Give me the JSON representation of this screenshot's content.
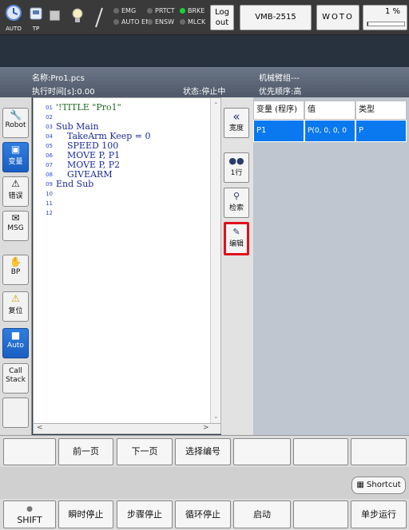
{
  "topbar": {
    "auto_label": "AUTO",
    "tp_label": "TP",
    "status": [
      {
        "label": "EMG",
        "on": false
      },
      {
        "label": "AUTO EN",
        "on": false
      },
      {
        "label": "PRTCT",
        "on": false
      },
      {
        "label": "ENSW",
        "on": false
      },
      {
        "label": "BRKE",
        "on": true
      },
      {
        "label": "MLCK",
        "on": false
      }
    ],
    "logout_label": "Log out",
    "robot_model": "VMB-2515",
    "woto_label": "WOTO",
    "speed_percent": "1 %",
    "speed_fraction": 0.01
  },
  "info": {
    "name": "名称:Pro1.pcs",
    "exec_time": "执行时间[s]:0.00",
    "state": "状态:停止中",
    "arm_group": "机械臂组---",
    "priority": "优先顺序:高"
  },
  "sidebar": {
    "robot": "Robot",
    "variable": "变量",
    "error": "错误",
    "msg": "MSG",
    "bp": "BP",
    "reset": "复位",
    "auto": "Auto",
    "callstack": "Call Stack"
  },
  "editor": {
    "lines": [
      {
        "num": "01",
        "text": "'!TITLE \"Pro1\""
      },
      {
        "num": "02",
        "text": ""
      },
      {
        "num": "03",
        "text": "Sub Main"
      },
      {
        "num": "04",
        "text": "    TakeArm Keep = 0"
      },
      {
        "num": "05",
        "text": "    SPEED 100"
      },
      {
        "num": "06",
        "text": "    MOVE P, P1"
      },
      {
        "num": "07",
        "text": "    MOVE P, P2"
      },
      {
        "num": "08",
        "text": "    GIVEARM"
      },
      {
        "num": "09",
        "text": "End Sub"
      },
      {
        "num": "10",
        "text": ""
      },
      {
        "num": "11",
        "text": ""
      },
      {
        "num": "12",
        "text": ""
      }
    ]
  },
  "midtools": {
    "width_label": "宽度",
    "line_label": "1行",
    "search_label": "检索",
    "edit_label": "编辑"
  },
  "vartable": {
    "headers": [
      "变量 (程序)",
      "值",
      "类型"
    ],
    "rows": [
      {
        "var": "P1",
        "value": "P(0, 0, 0, 0",
        "type": "P"
      }
    ]
  },
  "pagebar": {
    "prev": "前一页",
    "next": "下一页",
    "select": "选择编号"
  },
  "shortcut_label": "Shortcut",
  "bottombar": {
    "shift": "SHIFT",
    "instant_stop": "瞬时停止",
    "step_stop": "步骤停止",
    "cycle_stop": "循环停止",
    "start": "启动",
    "single_step": "单步运行"
  }
}
